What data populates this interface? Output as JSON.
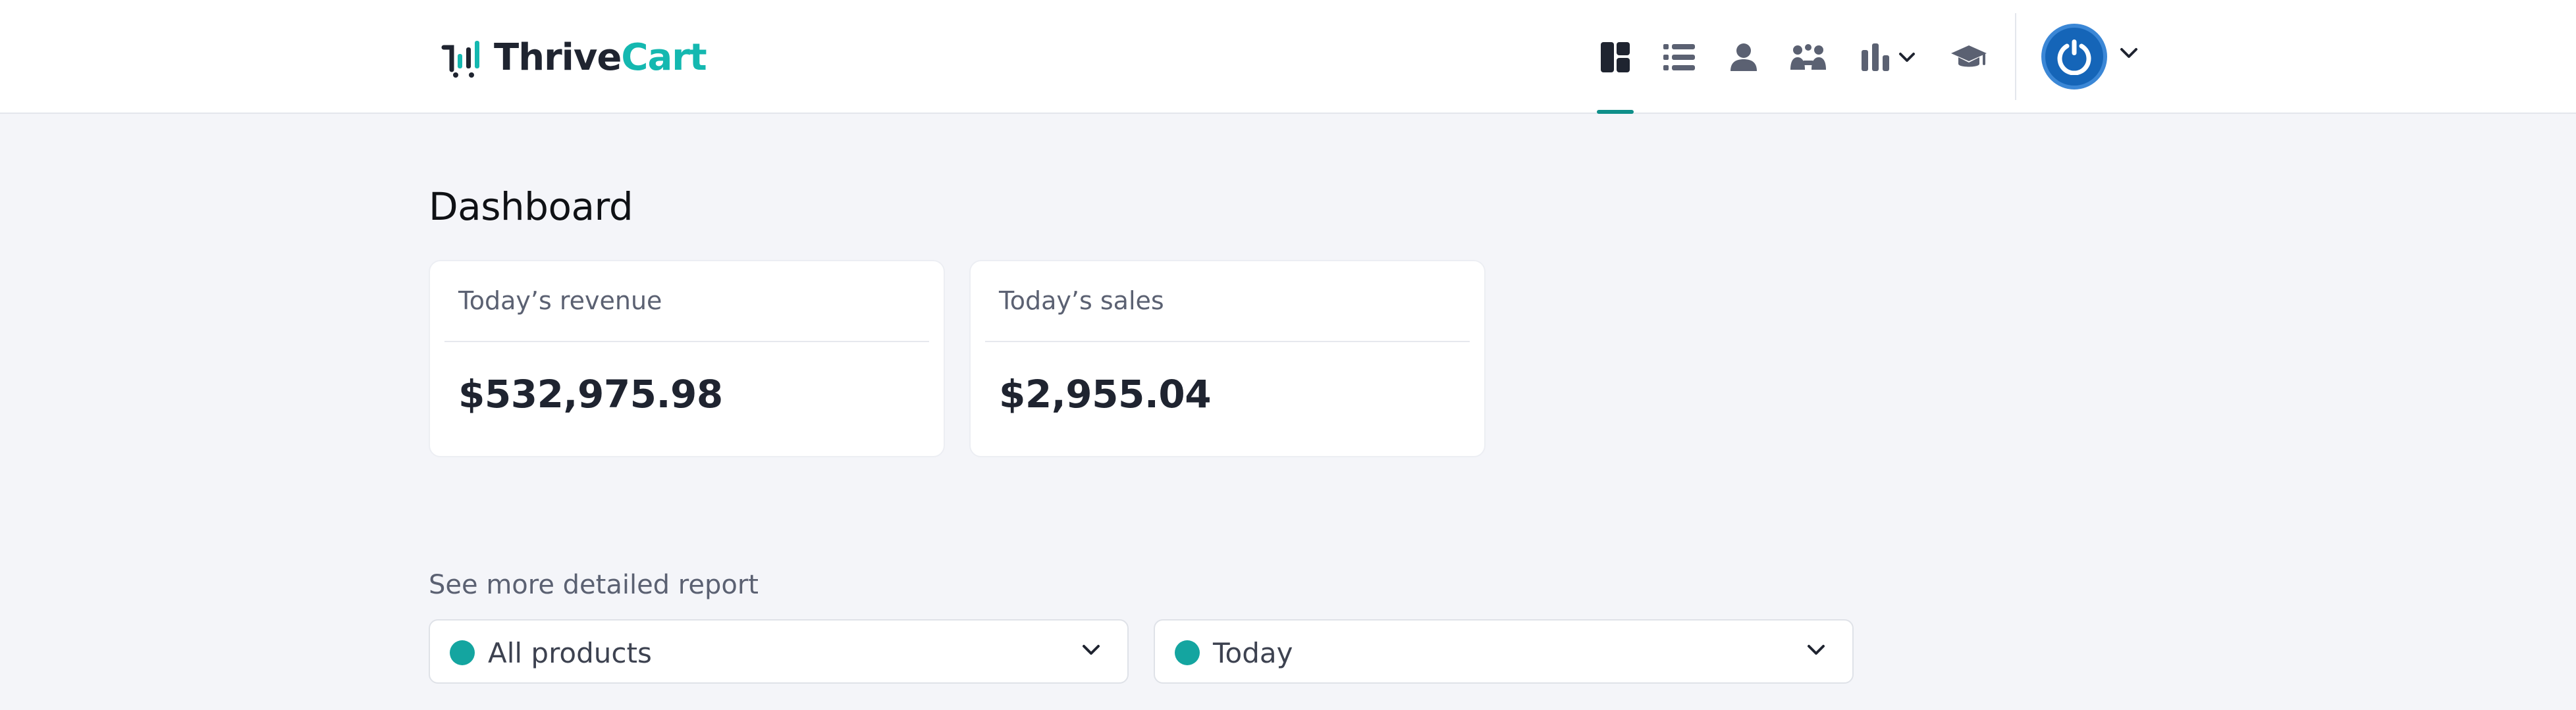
{
  "app": {
    "logo_part1": "Thrive",
    "logo_part2": "Cart",
    "brand_color": "#14b8b0",
    "accent_color": "#0f8f8a"
  },
  "nav": {
    "items": [
      {
        "name": "dashboard",
        "icon": "dashboard-icon",
        "active": true
      },
      {
        "name": "products",
        "icon": "list-icon"
      },
      {
        "name": "customers",
        "icon": "user-icon"
      },
      {
        "name": "affiliates",
        "icon": "affiliates-icon"
      },
      {
        "name": "reports",
        "icon": "bar-chart-icon",
        "has_dropdown": true
      },
      {
        "name": "learn",
        "icon": "graduation-cap-icon"
      }
    ],
    "account_icon": "power-icon"
  },
  "page": {
    "title": "Dashboard"
  },
  "stats": [
    {
      "label": "Today’s revenue",
      "value": "$532,975.98"
    },
    {
      "label": "Today’s sales",
      "value": "$2,955.04"
    }
  ],
  "report": {
    "label": "See more detailed report",
    "product_filter": "All products",
    "date_filter": "Today",
    "dot_color": "#14a5a0"
  }
}
